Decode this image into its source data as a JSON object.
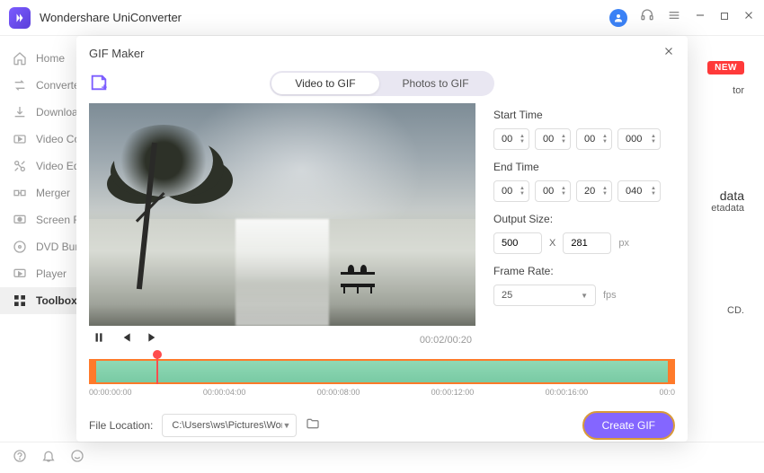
{
  "app": {
    "title": "Wondershare UniConverter"
  },
  "sidebar": {
    "items": [
      {
        "label": "Home"
      },
      {
        "label": "Converter"
      },
      {
        "label": "Downloader"
      },
      {
        "label": "Video Compressor"
      },
      {
        "label": "Video Editor"
      },
      {
        "label": "Merger"
      },
      {
        "label": "Screen Recorder"
      },
      {
        "label": "DVD Burner"
      },
      {
        "label": "Player"
      },
      {
        "label": "Toolbox"
      }
    ]
  },
  "bg": {
    "new_label": "NEW",
    "card1_suffix": "tor",
    "card2_title": "data",
    "card2_sub": "etadata",
    "card3_suffix": "CD."
  },
  "modal": {
    "title": "GIF Maker",
    "tabs": {
      "video": "Video to GIF",
      "photos": "Photos to GIF"
    },
    "player": {
      "time": "00:02/00:20"
    },
    "settings": {
      "start_label": "Start Time",
      "start": {
        "h": "00",
        "m": "00",
        "s": "00",
        "ms": "000"
      },
      "end_label": "End Time",
      "end": {
        "h": "00",
        "m": "00",
        "s": "20",
        "ms": "040"
      },
      "output_label": "Output Size:",
      "width": "500",
      "height": "281",
      "px": "px",
      "fr_label": "Frame Rate:",
      "fr_value": "25",
      "fps": "fps"
    },
    "ruler": {
      "t0": "00:00:00:00",
      "t1": "00:00:04:00",
      "t2": "00:00:08:00",
      "t3": "00:00:12:00",
      "t4": "00:00:16:00",
      "t5": "00:0"
    },
    "footer": {
      "label": "File Location:",
      "path": "C:\\Users\\ws\\Pictures\\Wonders",
      "create": "Create GIF"
    }
  }
}
